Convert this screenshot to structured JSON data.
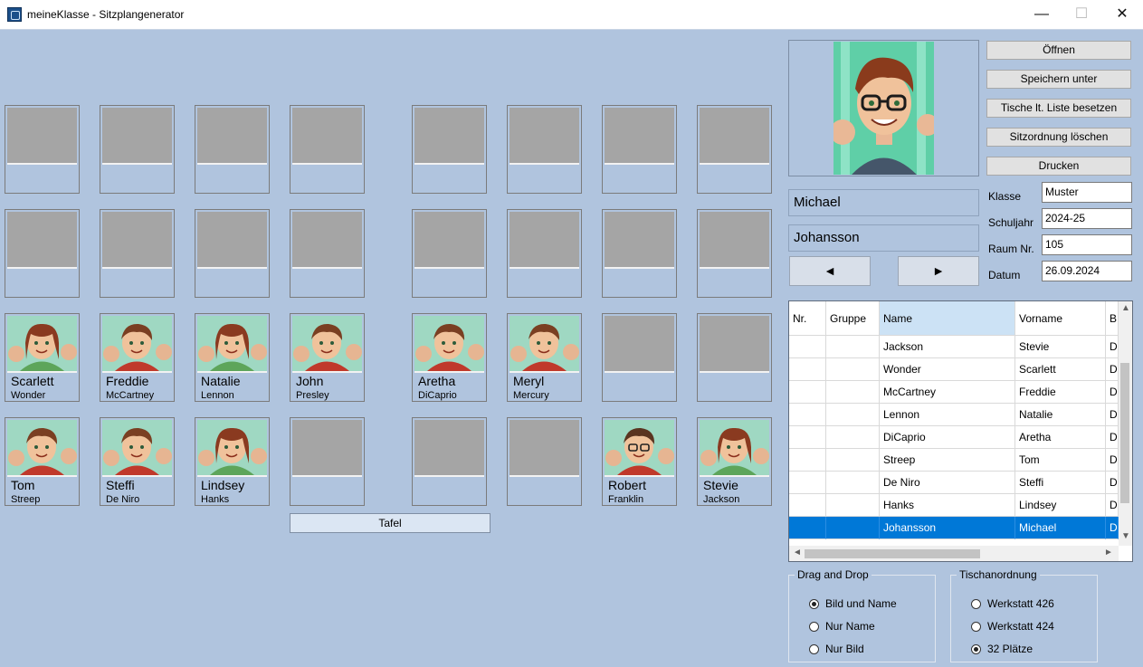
{
  "window": {
    "title": "meineKlasse - Sitzplangenerator",
    "minimize": "—",
    "maximize": "☐",
    "close": "✕"
  },
  "desks": [
    {
      "first": "",
      "last": "",
      "avatar": ""
    },
    {
      "first": "",
      "last": "",
      "avatar": ""
    },
    {
      "first": "",
      "last": "",
      "avatar": ""
    },
    {
      "first": "",
      "last": "",
      "avatar": ""
    },
    {
      "first": "",
      "last": "",
      "avatar": ""
    },
    {
      "first": "",
      "last": "",
      "avatar": ""
    },
    {
      "first": "",
      "last": "",
      "avatar": ""
    },
    {
      "first": "",
      "last": "",
      "avatar": ""
    },
    {
      "first": "",
      "last": "",
      "avatar": ""
    },
    {
      "first": "",
      "last": "",
      "avatar": ""
    },
    {
      "first": "",
      "last": "",
      "avatar": ""
    },
    {
      "first": "",
      "last": "",
      "avatar": ""
    },
    {
      "first": "",
      "last": "",
      "avatar": ""
    },
    {
      "first": "",
      "last": "",
      "avatar": ""
    },
    {
      "first": "",
      "last": "",
      "avatar": ""
    },
    {
      "first": "",
      "last": "",
      "avatar": ""
    },
    {
      "first": "Scarlett",
      "last": "Wonder",
      "avatar": "girl-avatar"
    },
    {
      "first": "Freddie",
      "last": "McCartney",
      "avatar": "boy-avatar"
    },
    {
      "first": "Natalie",
      "last": "Lennon",
      "avatar": "girl-avatar"
    },
    {
      "first": "John",
      "last": "Presley",
      "avatar": "boy-avatar"
    },
    {
      "first": "Aretha",
      "last": "DiCaprio",
      "avatar": "boy-avatar"
    },
    {
      "first": "Meryl",
      "last": "Mercury",
      "avatar": "boy-avatar"
    },
    {
      "first": "",
      "last": "",
      "avatar": ""
    },
    {
      "first": "",
      "last": "",
      "avatar": ""
    },
    {
      "first": "Tom",
      "last": "Streep",
      "avatar": "boy-avatar"
    },
    {
      "first": "Steffi",
      "last": "De Niro",
      "avatar": "boy-avatar"
    },
    {
      "first": "Lindsey",
      "last": "Hanks",
      "avatar": "girl-avatar"
    },
    {
      "first": "",
      "last": "",
      "avatar": ""
    },
    {
      "first": "",
      "last": "",
      "avatar": ""
    },
    {
      "first": "",
      "last": "",
      "avatar": ""
    },
    {
      "first": "Robert",
      "last": "Franklin",
      "avatar": "boy-glasses-avatar"
    },
    {
      "first": "Stevie",
      "last": "Jackson",
      "avatar": "girl-avatar"
    }
  ],
  "board_label": "Tafel",
  "colors": {
    "background": "#b0c4de",
    "selection": "#0078d7",
    "empty_photo": "#a5a5a5",
    "header_selected": "#cce2f5"
  },
  "buttons": {
    "open": "Öffnen",
    "save_as": "Speichern unter",
    "fill_from_list": "Tische lt. Liste besetzen",
    "clear_seating": "Sitzordnung löschen",
    "print": "Drucken"
  },
  "selected": {
    "first_name": "Michael",
    "last_name": "Johansson",
    "avatar": "boy-glasses-avatar"
  },
  "nav": {
    "prev": "◄",
    "next": "►"
  },
  "fields": [
    {
      "label": "Klasse",
      "value": "Muster"
    },
    {
      "label": "Schuljahr",
      "value": "2024-25"
    },
    {
      "label": "Raum Nr.",
      "value": "105"
    },
    {
      "label": "Datum",
      "value": "26.09.2024"
    }
  ],
  "table": {
    "columns": [
      "Nr.",
      "Gruppe",
      "Name",
      "Vorname",
      "B"
    ],
    "sorted_column": "Name",
    "rows": [
      {
        "nr": "",
        "gruppe": "",
        "name": "Jackson",
        "vorname": "Stevie",
        "extra": "D"
      },
      {
        "nr": "",
        "gruppe": "",
        "name": "Wonder",
        "vorname": "Scarlett",
        "extra": "D"
      },
      {
        "nr": "",
        "gruppe": "",
        "name": "McCartney",
        "vorname": "Freddie",
        "extra": "D"
      },
      {
        "nr": "",
        "gruppe": "",
        "name": "Lennon",
        "vorname": "Natalie",
        "extra": "D"
      },
      {
        "nr": "",
        "gruppe": "",
        "name": "DiCaprio",
        "vorname": "Aretha",
        "extra": "D"
      },
      {
        "nr": "",
        "gruppe": "",
        "name": "Streep",
        "vorname": "Tom",
        "extra": "D"
      },
      {
        "nr": "",
        "gruppe": "",
        "name": "De Niro",
        "vorname": "Steffi",
        "extra": "D"
      },
      {
        "nr": "",
        "gruppe": "",
        "name": "Hanks",
        "vorname": "Lindsey",
        "extra": "D"
      },
      {
        "nr": "",
        "gruppe": "",
        "name": "Johansson",
        "vorname": "Michael",
        "extra": "D"
      }
    ],
    "selected_row": 8
  },
  "drag_drop": {
    "title": "Drag and Drop",
    "options": [
      "Bild und Name",
      "Nur Name",
      "Nur Bild"
    ],
    "selected": 0
  },
  "arrangement": {
    "title": "Tischanordnung",
    "options": [
      "Werkstatt 426",
      "Werkstatt 424",
      "32 Plätze"
    ],
    "selected": 2
  }
}
